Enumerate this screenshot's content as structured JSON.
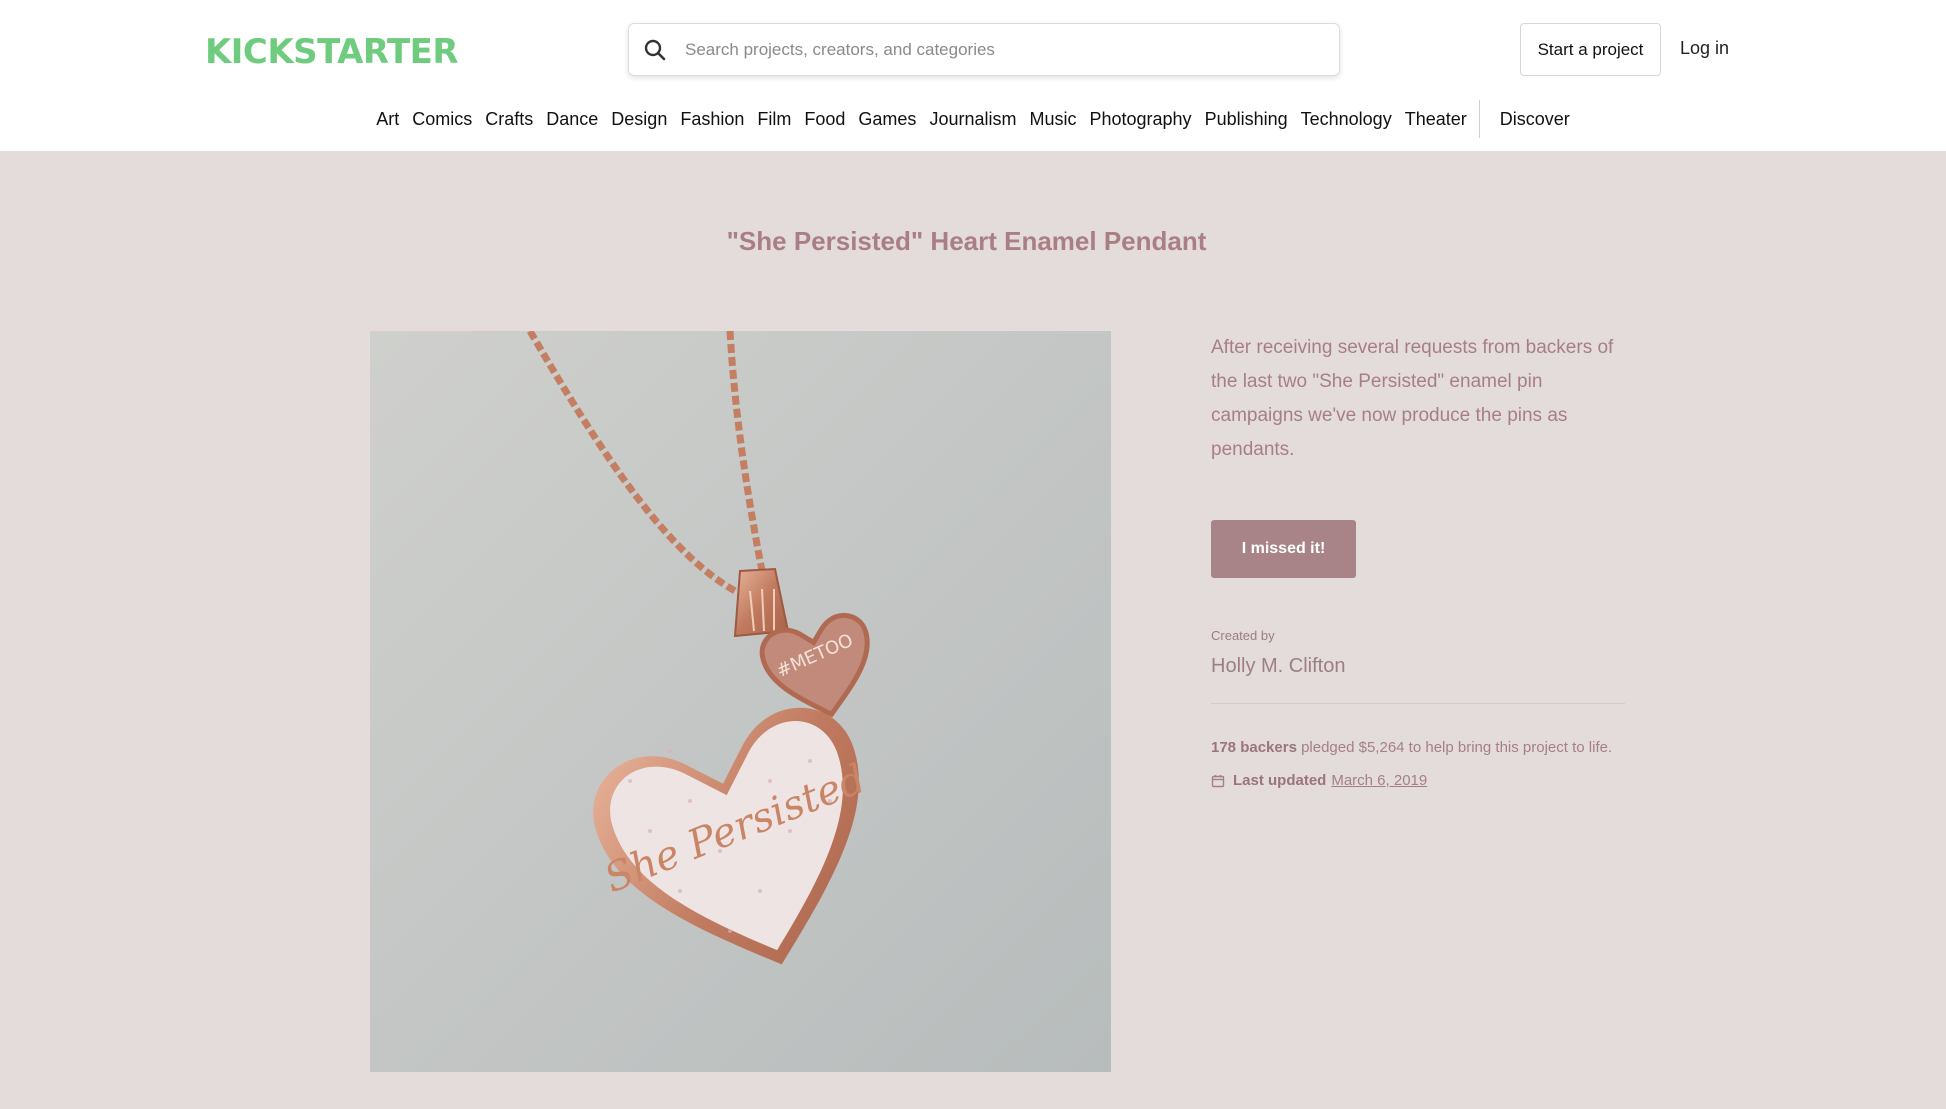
{
  "header": {
    "logo_text": "KICKSTARTER",
    "search_placeholder": "Search projects, creators, and categories",
    "start_project_label": "Start a project",
    "login_label": "Log in"
  },
  "nav": {
    "categories": [
      "Art",
      "Comics",
      "Crafts",
      "Dance",
      "Design",
      "Fashion",
      "Film",
      "Food",
      "Games",
      "Journalism",
      "Music",
      "Photography",
      "Publishing",
      "Technology",
      "Theater"
    ],
    "discover_label": "Discover"
  },
  "project": {
    "title": "\"She Persisted\" Heart Enamel Pendant",
    "blurb": "After receiving several requests from backers of the last two \"She Persisted\" enamel pin campaigns we've now produce the pins as pendants.",
    "missed_button": "I missed it!",
    "created_by_label": "Created by",
    "creator": "Holly M. Clifton",
    "backers": "178 backers",
    "pledge_text": " pledged $5,264 to help bring this project to life.",
    "last_updated_label": "Last updated",
    "last_updated_date": "March 6, 2019",
    "image_text_heart": "She Persisted",
    "image_text_charm": "#METOO"
  },
  "colors": {
    "brand_green": "#05ce78",
    "page_bg": "#e4dcdb",
    "accent": "#a88488"
  }
}
